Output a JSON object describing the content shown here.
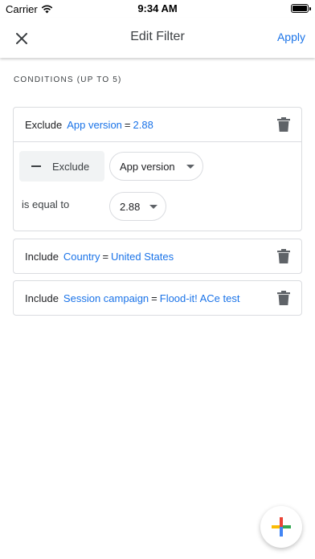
{
  "status_bar": {
    "carrier": "Carrier",
    "time": "9:34 AM"
  },
  "header": {
    "title": "Edit Filter",
    "apply_label": "Apply"
  },
  "section": {
    "label": "CONDITIONS (UP TO 5)"
  },
  "conditions": [
    {
      "verb": "Exclude",
      "dimension": "App version",
      "operator": "=",
      "value": "2.88",
      "editor": {
        "mode_button": "Exclude",
        "dimension_dropdown": "App version",
        "match_label": "is equal to",
        "value_dropdown": "2.88"
      }
    },
    {
      "verb": "Include",
      "dimension": "Country",
      "operator": "=",
      "value": "United States"
    },
    {
      "verb": "Include",
      "dimension": "Session campaign",
      "operator": "=",
      "value": "Flood-it! ACe test"
    }
  ],
  "colors": {
    "accent": "#1a73e8",
    "fab_blue": "#4285f4",
    "fab_red": "#ea4335",
    "fab_yellow": "#fbbc04",
    "fab_green": "#34a853"
  },
  "icons": [
    "wifi-icon",
    "battery-icon",
    "close-icon",
    "trash-icon",
    "minus-icon",
    "caret-down-icon",
    "plus-icon"
  ]
}
